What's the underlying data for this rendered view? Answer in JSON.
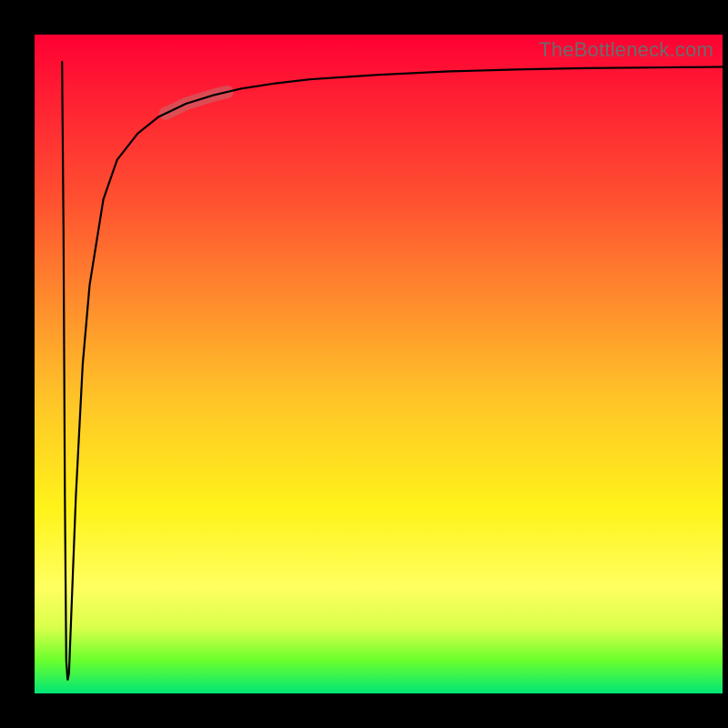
{
  "branding": {
    "label": "TheBottleneck.com"
  },
  "colors": {
    "top": "#ff0033",
    "mid": "#ffc328",
    "bottom": "#00e676",
    "line": "#000000",
    "band": "#c07070",
    "watermark": "#6b6b6b"
  },
  "chart_data": {
    "type": "line",
    "title": "",
    "xlabel": "",
    "ylabel": "",
    "xlim": [
      0,
      100
    ],
    "ylim": [
      0,
      100
    ],
    "grid": false,
    "legend": false,
    "series": [
      {
        "name": "downstroke",
        "description": "initial sharp vertical pulse near x≈4",
        "x": [
          4.0,
          4.2,
          4.4,
          4.6,
          4.8,
          5.0
        ],
        "y": [
          96,
          70,
          30,
          5,
          2,
          3
        ]
      },
      {
        "name": "recovery-curve",
        "description": "fast rise decaying to an asymptote near y≈95",
        "x": [
          5,
          6,
          7,
          8,
          10,
          12,
          15,
          18,
          22,
          26,
          30,
          35,
          40,
          50,
          60,
          70,
          80,
          90,
          100
        ],
        "y": [
          3,
          30,
          50,
          62,
          75,
          81,
          85,
          87.5,
          89.5,
          90.8,
          91.8,
          92.6,
          93.2,
          93.9,
          94.4,
          94.7,
          94.9,
          95.0,
          95.1
        ]
      }
    ],
    "highlight": {
      "name": "band",
      "description": "short thick semi-transparent segment near upper-left knee of curve",
      "x_range": [
        19,
        28
      ],
      "y_range": [
        87,
        90.5
      ]
    }
  }
}
